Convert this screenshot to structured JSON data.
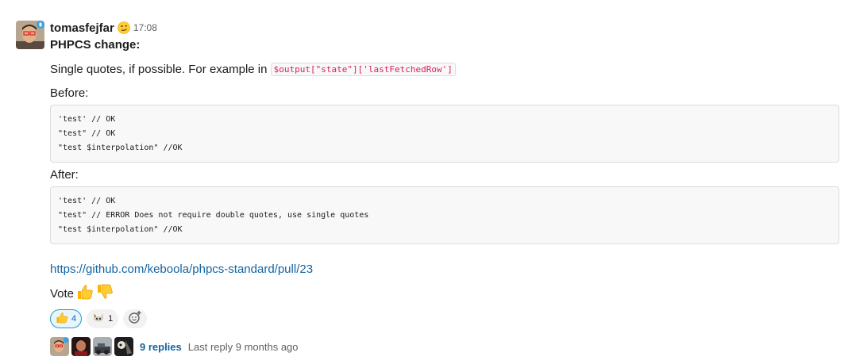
{
  "message": {
    "username": "tomasfejfar",
    "status_emoji": "smirk-face",
    "timestamp": "17:08",
    "heading": "PHPCS change:",
    "intro_text": "Single quotes, if possible. For example in",
    "inline_code": "$output[\"state\"]['lastFetchedRow']",
    "before_label": "Before:",
    "before_code": [
      "'test' // OK",
      "\"test\" // OK",
      "\"test $interpolation\" //OK"
    ],
    "after_label": "After:",
    "after_code": [
      "'test' // OK",
      "\"test\" // ERROR Does not require double quotes, use single quotes",
      "\"test $interpolation\" //OK"
    ],
    "link": "https://github.com/keboola/phpcs-standard/pull/23",
    "vote_text": "Vote"
  },
  "reactions": [
    {
      "icon": "thumbs-up-icon",
      "count": "4",
      "active": true
    },
    {
      "icon": "cat-face-icon",
      "count": "1",
      "active": false
    }
  ],
  "thread": {
    "replies_label": "9 replies",
    "last_reply": "Last reply 9 months ago"
  },
  "colors": {
    "link": "#1264a3",
    "inline_code": "#e01e5a",
    "active_reaction_border": "#1d9bd1",
    "code_background": "#f8f8f8"
  }
}
